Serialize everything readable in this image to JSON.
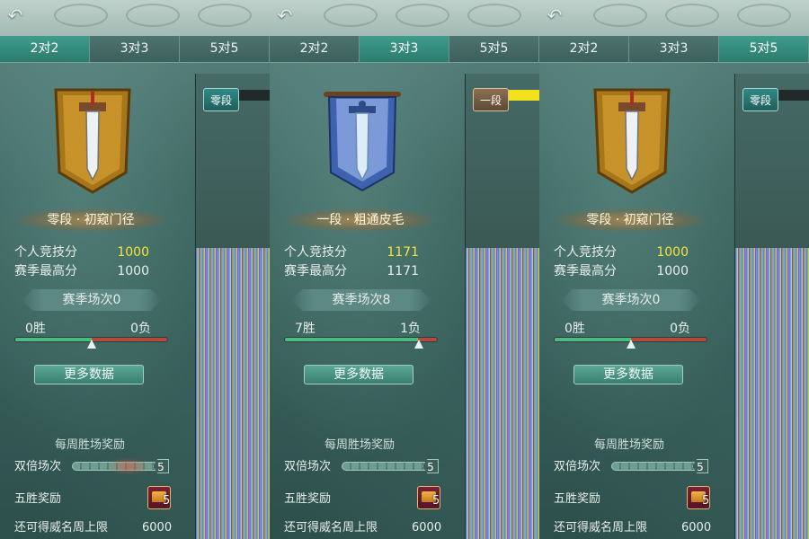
{
  "panels": [
    {
      "tabs": [
        "2对2",
        "3对3",
        "5对5"
      ],
      "active_tab": 0,
      "rank_title": "零段 · 初窥门径",
      "score_label": "个人竞技分",
      "score_value": "1000",
      "best_label": "赛季最高分",
      "best_value": "1000",
      "season_matches": "赛季场次0",
      "wins": "0胜",
      "losses": "0负",
      "win_ratio": 0.5,
      "more_btn": "更多数据",
      "weekly_title": "每周胜场奖励",
      "double_label": "双倍场次",
      "double_count": "5",
      "five_label": "五胜奖励",
      "chest_count": "5",
      "limit_label": "还可得威名周上限",
      "limit_value": "6000",
      "ladder_badge": "零段",
      "emblem": "gold-sword-banner"
    },
    {
      "tabs": [
        "2对2",
        "3对3",
        "5对5"
      ],
      "active_tab": 1,
      "rank_title": "一段 · 粗通皮毛",
      "score_label": "个人竞技分",
      "score_value": "1171",
      "best_label": "赛季最高分",
      "best_value": "1171",
      "season_matches": "赛季场次8",
      "wins": "7胜",
      "losses": "1负",
      "win_ratio": 0.875,
      "more_btn": "更多数据",
      "weekly_title": "每周胜场奖励",
      "double_label": "双倍场次",
      "double_count": "5",
      "five_label": "五胜奖励",
      "chest_count": "5",
      "limit_label": "还可得威名周上限",
      "limit_value": "6000",
      "ladder_badge": "一段",
      "emblem": "blue-sword-banner"
    },
    {
      "tabs": [
        "2对2",
        "3对3",
        "5对5"
      ],
      "active_tab": 2,
      "rank_title": "零段 · 初窥门径",
      "score_label": "个人竞技分",
      "score_value": "1000",
      "best_label": "赛季最高分",
      "best_value": "1000",
      "season_matches": "赛季场次0",
      "wins": "0胜",
      "losses": "0负",
      "win_ratio": 0.5,
      "more_btn": "更多数据",
      "weekly_title": "每周胜场奖励",
      "double_label": "双倍场次",
      "double_count": "5",
      "five_label": "五胜奖励",
      "chest_count": "5",
      "limit_label": "还可得威名周上限",
      "limit_value": "6000",
      "ladder_badge": "零段",
      "emblem": "gold-sword-banner"
    }
  ],
  "icons": {
    "back": "back-arrow-icon",
    "chest": "treasure-chest-icon"
  },
  "colors": {
    "score_highlight": "#f4e53a",
    "active_tab": "#2b7c6e",
    "win_bar": "#4bbb83",
    "loss_bar": "#b24b3c"
  }
}
